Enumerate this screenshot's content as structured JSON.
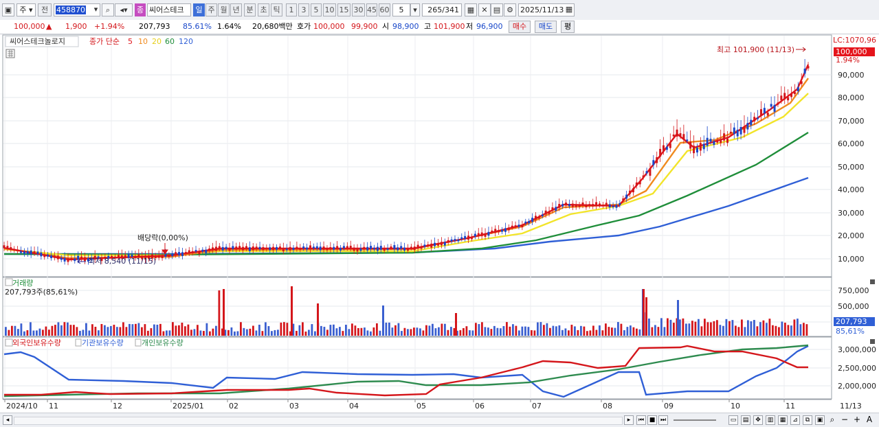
{
  "toolbar": {
    "market": "주",
    "prev": "전",
    "code": "458870",
    "type_icon": "종",
    "stock_name": "씨어스테크",
    "periods": [
      "일",
      "주",
      "월",
      "년",
      "분",
      "초",
      "틱"
    ],
    "period_selected": "일",
    "minutes": [
      "1",
      "3",
      "5",
      "10",
      "15",
      "30",
      "45",
      "60"
    ],
    "count_value": "5",
    "range": "265",
    "range_total": "/341",
    "date": "2025/11/13"
  },
  "quote": {
    "price": "100,000",
    "change": "1,900",
    "change_pct": "+1.94%",
    "volume": "207,793",
    "volume_ratio": "85.61%",
    "turnover": "1.64%",
    "amount": "20,680백만",
    "bid_label": "호가",
    "bid1": "100,000",
    "bid2": "99,900",
    "open_label": "시",
    "open": "98,900",
    "high_label": "고",
    "high": "101,900",
    "low_label": "저",
    "low": "96,900",
    "buy": "매수",
    "sell": "매도",
    "eval": "평"
  },
  "price_panel": {
    "legend_name": "씨어스테크놀로지",
    "legend_ma": "종가 단순",
    "ma_labels": [
      "5",
      "10",
      "20",
      "60",
      "120"
    ],
    "ma_colors": [
      "#e0141b",
      "#f08a1e",
      "#f2e42a",
      "#1f8e3a",
      "#2f5fd6"
    ],
    "high_note": "최고 101,900 (11/13)",
    "low_note": "최저 8,540 (11/15)",
    "dividend_note": "배당락(0,00%)",
    "lc_label": "LC:1070,96",
    "current_price_box": "100,000",
    "current_pct": "1.94%",
    "y_ticks": [
      "90,000",
      "80,000",
      "70,000",
      "60,000",
      "50,000",
      "40,000",
      "30,000",
      "20,000",
      "10,000"
    ]
  },
  "volume_panel": {
    "title": "거래량",
    "value_note": "207,793주(85,61%)",
    "y_ticks": [
      "750,000",
      "500,000",
      "250,000"
    ],
    "current_box": "207,793",
    "current_pct": "85,61%"
  },
  "holdings_panel": {
    "series": [
      "외국인보유수량",
      "기관보유수량",
      "개인보유수량"
    ],
    "colors": [
      "#d4161b",
      "#2f5fd6",
      "#2e8b4f"
    ],
    "y_ticks": [
      "3,000,000",
      "2,500,000",
      "2,000,000"
    ]
  },
  "x_axis": {
    "labels": [
      "2024/10",
      "11",
      "12",
      "2025/01",
      "02",
      "03",
      "04",
      "05",
      "06",
      "07",
      "08",
      "09",
      "10",
      "11"
    ],
    "current_label": "11/13"
  },
  "colors": {
    "up": "#d4161b",
    "down": "#1847c9",
    "grid": "#e3e5e9",
    "panel_border": "#9aa0a8"
  }
}
